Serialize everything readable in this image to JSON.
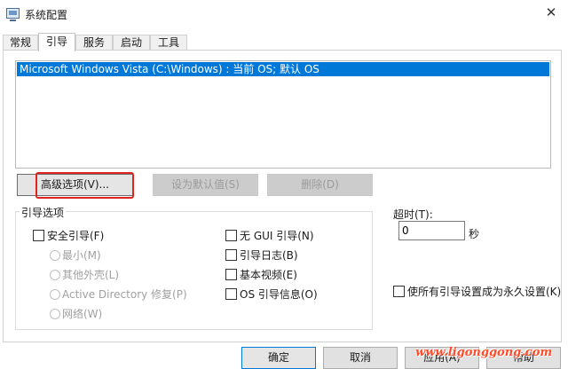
{
  "window": {
    "title": "系统配置",
    "close_glyph": "✕"
  },
  "tabs": [
    {
      "label": "常规",
      "active": false
    },
    {
      "label": "引导",
      "active": true
    },
    {
      "label": "服务",
      "active": false
    },
    {
      "label": "启动",
      "active": false
    },
    {
      "label": "工具",
      "active": false
    }
  ],
  "os_list": {
    "items": [
      "Microsoft Windows Vista (C:\\Windows) : 当前 OS; 默认 OS"
    ]
  },
  "buttons": {
    "advanced": "高级选项(V)...",
    "set_default": "设为默认值(S)",
    "delete": "删除(D)"
  },
  "boot_options": {
    "label": "引导选项",
    "safe_boot": "安全引导(F)",
    "minimal": "最小(M)",
    "alternate_shell": "其他外壳(L)",
    "ad_repair": "Active Directory 修复(P)",
    "network": "网络(W)",
    "no_gui": "无 GUI 引导(N)",
    "boot_log": "引导日志(B)",
    "base_video": "基本视频(E)",
    "os_info": "OS 引导信息(O)"
  },
  "timeout": {
    "label": "超时(T):",
    "value": "0",
    "unit": "秒"
  },
  "permanent": {
    "label": "使所有引导设置成为永久设置(K)"
  },
  "footer": {
    "ok": "确定",
    "cancel": "取消",
    "apply": "应用(A)",
    "help": "帮助"
  },
  "watermark": "www.ligonggong.com",
  "colors": {
    "selection": "#0078d7",
    "highlight_box": "#e0241f",
    "watermark": "#ff4b2a"
  }
}
